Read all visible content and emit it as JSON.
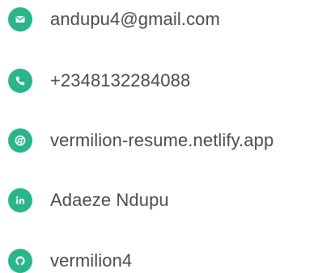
{
  "colors": {
    "accent": "#2bb58a",
    "text": "#4b4b4b",
    "background": "#ffffff"
  },
  "contacts": [
    {
      "icon": "envelope-icon",
      "text": "andupu4@gmail.com"
    },
    {
      "icon": "phone-icon",
      "text": "+2348132284088"
    },
    {
      "icon": "chrome-icon",
      "text": "vermilion-resume.netlify.app"
    },
    {
      "icon": "linkedin-icon",
      "text": "Adaeze Ndupu"
    },
    {
      "icon": "github-icon",
      "text": "vermilion4"
    }
  ]
}
